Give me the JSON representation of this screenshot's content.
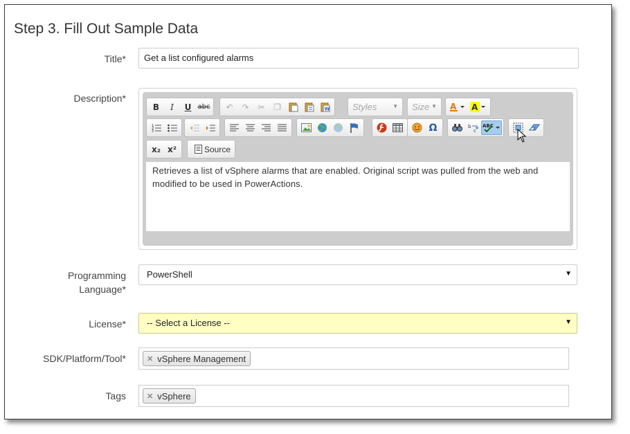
{
  "page": {
    "title": "Step 3. Fill Out Sample Data"
  },
  "form": {
    "title": {
      "label": "Title*",
      "value": "Get a list configured alarms"
    },
    "description": {
      "label": "Description*",
      "content": "Retrieves a list of vSphere alarms that are enabled. Original script was pulled from the web and modified to be used in PowerActions."
    },
    "language": {
      "label_line1": "Programming",
      "label_line2": "Language*",
      "value": "PowerShell"
    },
    "license": {
      "label": "License*",
      "value": "-- Select a License --"
    },
    "sdk": {
      "label": "SDK/Platform/Tool*",
      "tags": [
        "vSphere Management"
      ]
    },
    "tags": {
      "label": "Tags",
      "tags": [
        "vSphere"
      ]
    }
  },
  "editor": {
    "styles_placeholder": "Styles",
    "size_placeholder": "Size",
    "source_label": "Source",
    "bold_icon_text": "B",
    "italic_icon_text": "I",
    "underline_icon_text": "U",
    "strike_icon_text": "abc",
    "subscript_text": "x₂",
    "superscript_text": "x²",
    "spellcheck_text": "ABC"
  },
  "icons": {
    "toolbar": [
      "bold-icon",
      "italic-icon",
      "underline-icon",
      "strike-icon",
      "undo-icon",
      "redo-icon",
      "cut-icon",
      "copy-icon",
      "paste-icon",
      "paste-text-icon",
      "paste-word-icon",
      "text-color-icon",
      "background-color-icon",
      "numbered-list-icon",
      "bulleted-list-icon",
      "outdent-icon",
      "indent-icon",
      "align-left-icon",
      "align-center-icon",
      "align-right-icon",
      "justify-icon",
      "image-icon",
      "link-icon",
      "unlink-icon",
      "anchor-icon",
      "flash-icon",
      "table-icon",
      "smiley-icon",
      "special-char-icon",
      "find-icon",
      "replace-icon",
      "spellcheck-icon",
      "select-all-icon",
      "remove-format-icon",
      "subscript-icon",
      "superscript-icon",
      "source-icon"
    ],
    "tag_remove": "remove-tag-icon",
    "dropdown": "caret-down-icon"
  },
  "colors": {
    "license_bg": "#ffffc4",
    "editor_bg": "#cdcdcd",
    "active_button": "#a6cdf0"
  }
}
